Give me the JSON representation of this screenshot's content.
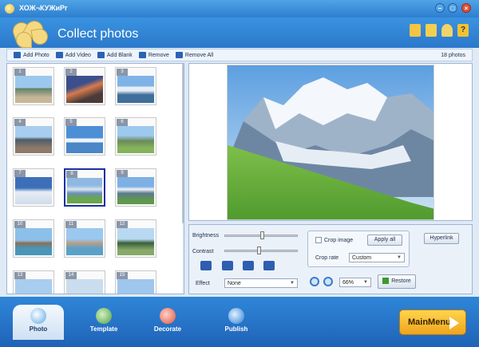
{
  "window": {
    "title": "ХОЖ¬КУЖиРг"
  },
  "header": {
    "title": "Collect photos",
    "accent": "#2d7fd0"
  },
  "toolbar": {
    "items": [
      {
        "label": "Add Photo",
        "icon": "add-photo-icon"
      },
      {
        "label": "Add Video",
        "icon": "add-video-icon"
      },
      {
        "label": "Add Blank",
        "icon": "add-blank-icon"
      },
      {
        "label": "Remove",
        "icon": "remove-icon"
      },
      {
        "label": "Remove All",
        "icon": "remove-all-icon"
      }
    ],
    "count": "18 photos"
  },
  "thumbnails": [
    {
      "num": "1"
    },
    {
      "num": "2"
    },
    {
      "num": "3"
    },
    {
      "num": "4"
    },
    {
      "num": "5"
    },
    {
      "num": "6"
    },
    {
      "num": "7"
    },
    {
      "num": "8",
      "selected": true
    },
    {
      "num": "9"
    },
    {
      "num": "10"
    },
    {
      "num": "11"
    },
    {
      "num": "12"
    },
    {
      "num": "13"
    },
    {
      "num": "14"
    },
    {
      "num": "15"
    }
  ],
  "controls": {
    "brightness_label": "Brightness",
    "contrast_label": "Contrast",
    "effect_label": "Effect",
    "effect_value": "None",
    "crop_image_label": "Crop image",
    "apply_all_label": "Apply all",
    "crop_rate_label": "Crop rate",
    "crop_rate_value": "Custom",
    "hyperlink_label": "Hyperlink",
    "zoom_value": "66%",
    "restore_label": "Restore"
  },
  "nav": {
    "tabs": [
      {
        "label": "Photo",
        "active": true
      },
      {
        "label": "Template"
      },
      {
        "label": "Decorate"
      },
      {
        "label": "Publish"
      }
    ],
    "mainmenu_label": "MainMenu"
  }
}
